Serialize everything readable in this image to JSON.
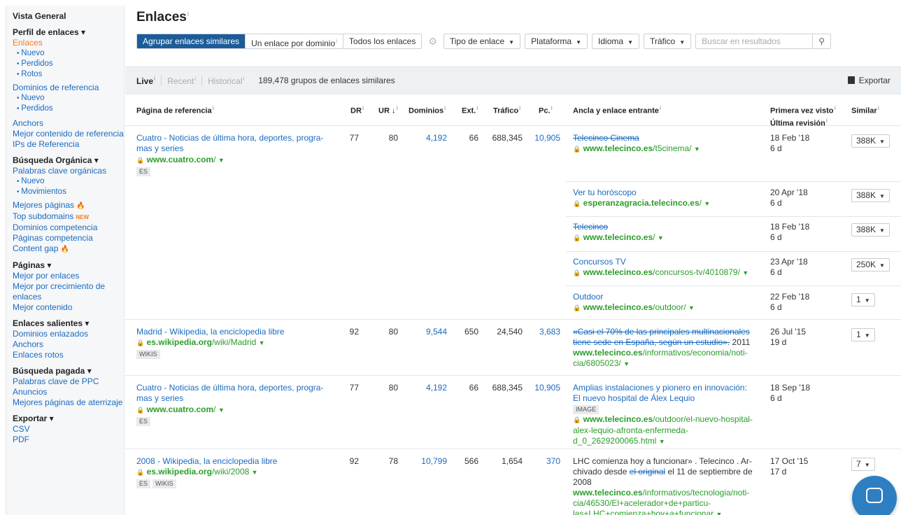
{
  "sidebar": {
    "overview": "Vista General",
    "backlink_profile": "Perfil de enlaces ▾",
    "links": "Enlaces",
    "links_new": "Nuevo",
    "links_lost": "Perdidos",
    "links_broken": "Rotos",
    "ref_domains": "Dominios de referencia",
    "ref_new": "Nuevo",
    "ref_lost": "Perdidos",
    "anchors": "Anchors",
    "best_content_ref": "Mejor contenido de referencia",
    "ref_ips": "IPs de Referencia",
    "organic_search": "Búsqueda Orgánica ▾",
    "organic_keywords": "Palabras clave orgánicas",
    "org_new": "Nuevo",
    "org_moves": "Movimientos",
    "top_pages": "Mejores páginas",
    "top_subdomains": "Top subdomains",
    "new_badge": "NEW",
    "competing_domains": "Dominios competencia",
    "competing_pages": "Páginas competencia",
    "content_gap": "Content gap",
    "pages": "Páginas ▾",
    "best_by_links": "Mejor por enlaces",
    "best_by_growth": "Mejor por crecimiento de enlaces",
    "best_content": "Mejor contenido",
    "outgoing_links": "Enlaces salientes ▾",
    "linked_domains": "Dominios enlazados",
    "out_anchors": "Anchors",
    "broken_links": "Enlaces rotos",
    "paid_search": "Búsqueda pagada ▾",
    "ppc_keywords": "Palabras clave de PPC",
    "ads": "Anuncios",
    "best_landing": "Mejores páginas de aterrizaje",
    "export": "Exportar ▾",
    "csv": "CSV",
    "pdf": "PDF"
  },
  "header": {
    "title": "Enlaces",
    "info": "i"
  },
  "toolbar": {
    "group_similar": "Agrupar enlaces similares",
    "one_per_domain": "Un enlace por dominio",
    "all_links": "Todos los enlaces",
    "link_type": "Tipo de enlace",
    "platform": "Plataforma",
    "language": "Idioma",
    "traffic": "Tráfico",
    "search_placeholder": "Buscar en resultados"
  },
  "status": {
    "live": "Live",
    "recent": "Recent",
    "historical": "Historical",
    "group_count": "189,478 grupos de enlaces similares",
    "export": "Exportar"
  },
  "columns": {
    "ref_page": "Página de referencia",
    "dr": "DR",
    "ur": "UR",
    "domains": "Dominios",
    "ext": "Ext.",
    "traffic": "Tráfico",
    "kw": "Pc.",
    "anchor": "Ancla y enlace entrante",
    "first_seen": "Primera vez visto",
    "last_check": "Última revisión",
    "similar": "Similar"
  },
  "rows": [
    {
      "title": "Cuatro - Noticias de última hora, deportes, progra-mas y series",
      "domain": "www.cuatro.com",
      "path": "/",
      "tags": [
        "ES"
      ],
      "dr": "77",
      "ur": "80",
      "domains": "4,192",
      "ext": "66",
      "traffic": "688,345",
      "kw": "10,905",
      "anchors": [
        {
          "text": "Telecinco Cinema",
          "domain": "www.telecinco.es",
          "path": "/t5cinema/",
          "first": "18 Feb '18",
          "last": "6 d",
          "similar": "388K"
        },
        {
          "text": "Ver tu horóscopo",
          "domain": "esperanzagracia.telecinco.es",
          "path": "/",
          "first": "20 Apr '18",
          "last": "6 d",
          "similar": "388K"
        },
        {
          "text": "Telecinco",
          "domain": "www.telecinco.es",
          "path": "/",
          "first": "18 Feb '18",
          "last": "6 d",
          "similar": "388K"
        },
        {
          "text": "Concursos TV",
          "domain": "www.telecinco.es",
          "path": "/concursos-tv/4010879/",
          "first": "23 Apr '18",
          "last": "6 d",
          "similar": "250K"
        },
        {
          "text": "Outdoor",
          "domain": "www.telecinco.es",
          "path": "/outdoor/",
          "first": "22 Feb '18",
          "last": "6 d",
          "similar": "1"
        }
      ]
    },
    {
      "title": "Madrid - Wikipedia, la enciclopedia libre",
      "domain": "es.wikipedia.org",
      "path": "/wiki/Madrid",
      "tags": [
        "WIKIS"
      ],
      "dr": "92",
      "ur": "80",
      "domains": "9,544",
      "ext": "650",
      "traffic": "24,540",
      "kw": "3,683",
      "anchor_text": "«Casi el 70% de las principales multinacionales tiene sede en España, según un estudio».",
      "anchor_after": " 2011",
      "anchor_domain": "www.telecinco.es",
      "anchor_path": "/informativos/economia/noti-cia/6805023/",
      "first": "26 Jul '15",
      "last": "19 d",
      "similar": "1"
    },
    {
      "title": "Cuatro - Noticias de última hora, deportes, progra-mas y series",
      "domain": "www.cuatro.com",
      "path": "/",
      "tags": [
        "ES"
      ],
      "dr": "77",
      "ur": "80",
      "domains": "4,192",
      "ext": "66",
      "traffic": "688,345",
      "kw": "10,905",
      "anchor_text": "Amplias instalaciones y pionero en innovación: El nuevo hospital de Álex Lequio",
      "anchor_tag": "IMAGE",
      "anchor_domain": "www.telecinco.es",
      "anchor_path": "/outdoor/el-nuevo-hospital-alex-lequio-afronta-enfermeda-d_0_2629200065.html",
      "first": "18 Sep '18",
      "last": "6 d"
    },
    {
      "title": "2008 - Wikipedia, la enciclopedia libre",
      "domain": "es.wikipedia.org",
      "path": "/wiki/2008",
      "tags": [
        "ES",
        "WIKIS"
      ],
      "dr": "92",
      "ur": "78",
      "domains": "10,799",
      "ext": "566",
      "traffic": "1,654",
      "kw": "370",
      "anchor_pre": "LHC comienza hoy a funcionar» . Telecinco . Ar-chivado desde ",
      "anchor_link": "el original",
      "anchor_post": " el 11 de septiembre de 2008",
      "anchor_domain": "www.telecinco.es",
      "anchor_path": "/informativos/tecnologia/noti-cia/46530/El+acelerador+de+particu-las+LHC+comienza+hoy+a+funcionar",
      "first": "17 Oct '15",
      "last": "17 d",
      "similar": "7"
    }
  ]
}
